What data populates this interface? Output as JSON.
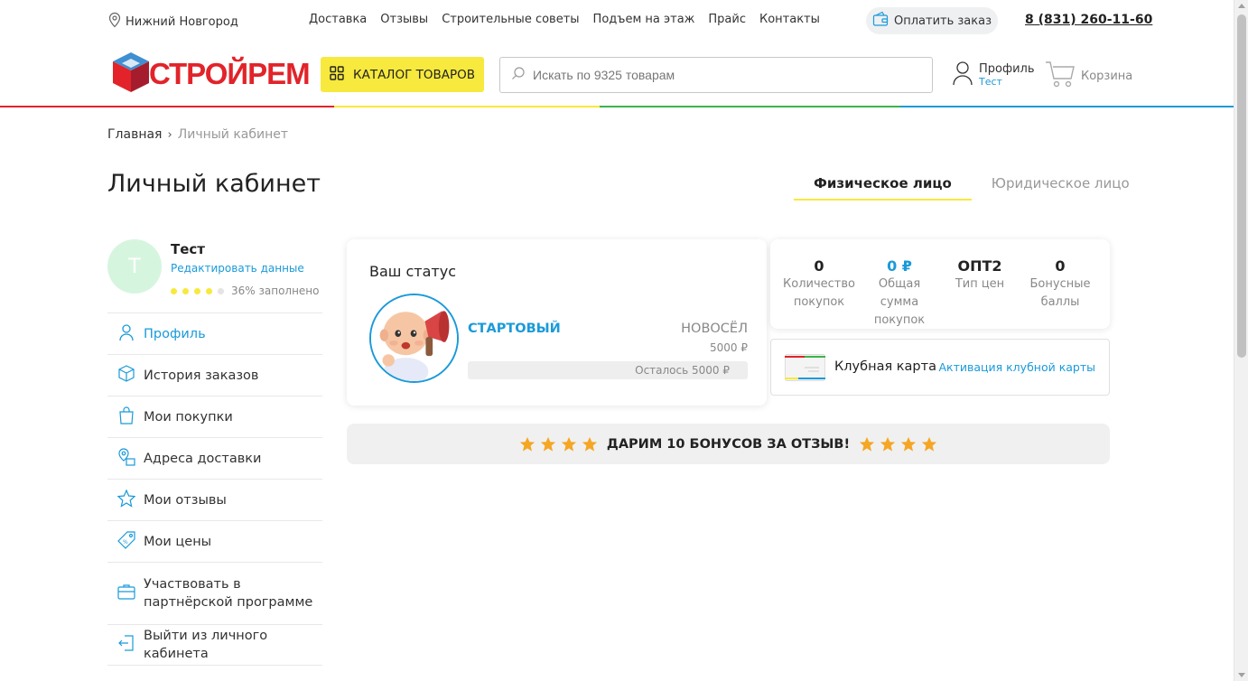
{
  "topbar": {
    "city": "Нижний Новгород",
    "nav": [
      "Доставка",
      "Отзывы",
      "Строительные советы",
      "Подъем на этаж",
      "Прайс",
      "Контакты"
    ],
    "pay_label": "Оплатить заказ",
    "phone": "8 (831) 260-11-60"
  },
  "header": {
    "logo_text": "СТРОЙРЕМ",
    "catalog_label": "КАТАЛОГ ТОВАРОВ",
    "search_placeholder": "Искать по 9325 товарам",
    "profile_label": "Профиль",
    "profile_user": "Тест",
    "cart_label": "Корзина"
  },
  "colors": {
    "accent_blue": "#1a9ad9",
    "accent_yellow": "#f7e93d",
    "brand_red": "#e2232a",
    "line": [
      "#e2232a",
      "#f7e93d",
      "#3cb44b",
      "#1a9ad9"
    ]
  },
  "breadcrumb": {
    "home": "Главная",
    "current": "Личный кабинет"
  },
  "page": {
    "title": "Личный кабинет",
    "tabs": [
      {
        "label": "Физическое лицо",
        "active": true
      },
      {
        "label": "Юридическое лицо",
        "active": false
      }
    ]
  },
  "user": {
    "initial": "Т",
    "name": "Тест",
    "edit_label": "Редактировать данные",
    "filled_dots": 4,
    "total_dots": 5,
    "fill_text": "36% заполнено"
  },
  "menu": [
    {
      "label": "Профиль",
      "icon": "user-icon",
      "active": true
    },
    {
      "label": "История заказов",
      "icon": "box-icon",
      "active": false
    },
    {
      "label": "Мои покупки",
      "icon": "shopping-bag-icon",
      "active": false
    },
    {
      "label": "Адреса доставки",
      "icon": "map-pin-icon",
      "active": false
    },
    {
      "label": "Мои отзывы",
      "icon": "star-icon",
      "active": false
    },
    {
      "label": "Мои цены",
      "icon": "price-tag-icon",
      "active": false
    },
    {
      "label": "Участвовать в партнёрской программе",
      "icon": "briefcase-icon",
      "active": false
    },
    {
      "label": "Выйти из личного кабинета",
      "icon": "logout-icon",
      "active": false
    }
  ],
  "status": {
    "title": "Ваш статус",
    "level": "СТАРТОВЫЙ",
    "next_level": "НОВОСЁЛ",
    "next_sum": "5000 ₽",
    "remaining": "Осталось 5000 ₽",
    "progress": 0
  },
  "stats": [
    {
      "value": "0",
      "label": "Количество покупок",
      "highlight": false
    },
    {
      "value": "0 ₽",
      "label": "Общая сумма покупок",
      "highlight": true
    },
    {
      "value": "ОПТ2",
      "label": "Тип цен",
      "highlight": false
    },
    {
      "value": "0",
      "label": "Бонусные баллы",
      "highlight": false
    }
  ],
  "club": {
    "title": "Клубная карта",
    "link": "Активация клубной карты"
  },
  "bonus": {
    "text": "ДАРИМ 10 БОНУСОВ ЗА ОТЗЫВ!",
    "stars_each_side": 4
  }
}
